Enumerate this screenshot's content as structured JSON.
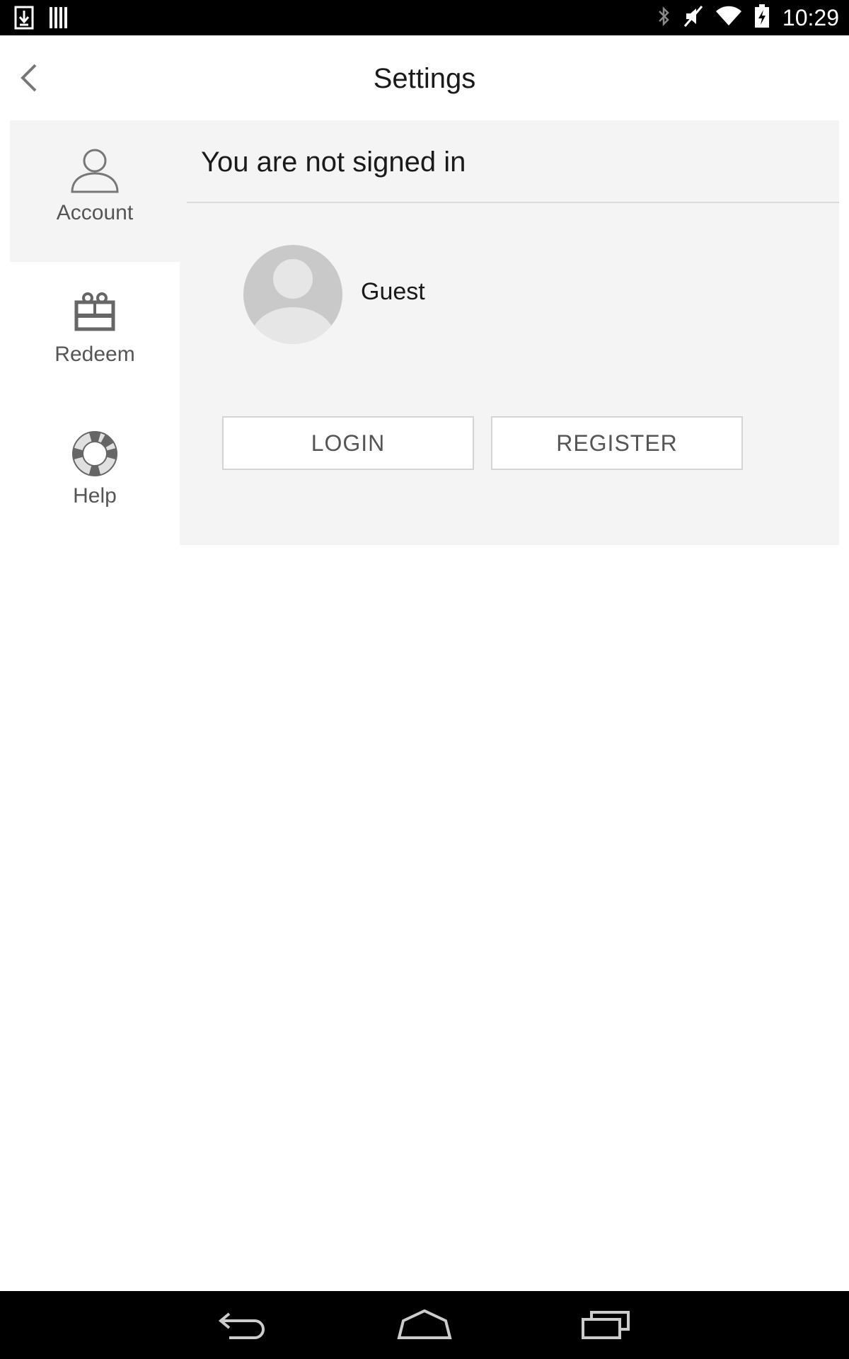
{
  "status_bar": {
    "time": "10:29",
    "left_icons": [
      "download-icon",
      "barcode-icon"
    ],
    "right_icons": [
      "bluetooth-icon",
      "mute-icon",
      "wifi-icon",
      "battery-icon"
    ]
  },
  "header": {
    "title": "Settings",
    "back_icon": "chevron-left-icon"
  },
  "sidebar": {
    "items": [
      {
        "label": "Account",
        "icon": "user-icon",
        "active": true
      },
      {
        "label": "Redeem",
        "icon": "gift-icon",
        "active": false
      },
      {
        "label": "Help",
        "icon": "lifebuoy-icon",
        "active": false
      }
    ]
  },
  "account": {
    "status": "You are not signed in",
    "username": "Guest",
    "login_label": "LOGIN",
    "register_label": "REGISTER"
  },
  "nav_bar": {
    "icons": [
      "back-icon",
      "home-icon",
      "recents-icon"
    ]
  }
}
